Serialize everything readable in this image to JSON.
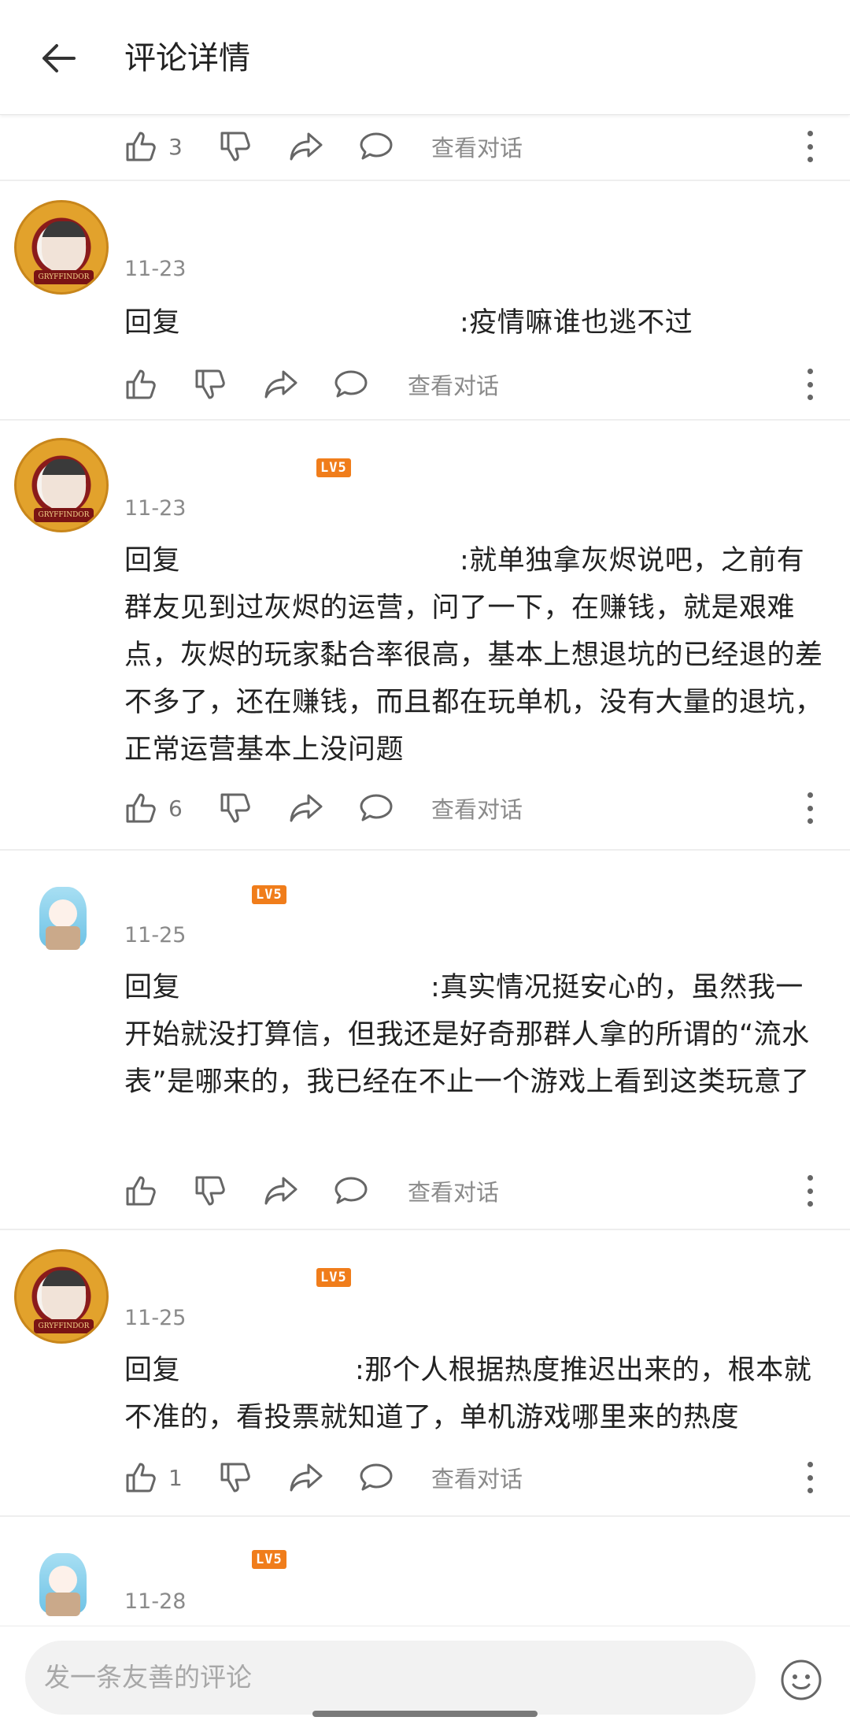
{
  "header": {
    "title": "评论详情"
  },
  "top_actions": {
    "like_count": "3",
    "view_dialog": "查看对话"
  },
  "comments": [
    {
      "date": "11-23",
      "reply_prefix": "回复",
      "reply_text": ":疫情嘛谁也逃不过",
      "like_count": "",
      "view_dialog": "查看对话"
    },
    {
      "date": "11-23",
      "level": "LV5",
      "reply_prefix": "回复",
      "reply_text": ":就单独拿灰烬说吧，之前有群友见到过灰烬的运营，问了一下，在赚钱，就是艰难点，灰烬的玩家黏合率很高，基本上想退坑的已经退的差不多了，还在赚钱，而且都在玩单机，没有大量的退坑，正常运营基本上没问题",
      "like_count": "6",
      "view_dialog": "查看对话"
    },
    {
      "date": "11-25",
      "level": "LV5",
      "reply_prefix": "回复",
      "reply_text": ":真实情况挺安心的，虽然我一开始就没打算信，但我还是好奇那群人拿的所谓的“流水表”是哪来的，我已经在不止一个游戏上看到这类玩意了",
      "like_count": "",
      "view_dialog": "查看对话"
    },
    {
      "date": "11-25",
      "level": "LV5",
      "reply_prefix": "回复",
      "reply_text": ":那个人根据热度推迟出来的，根本就不准的，看投票就知道了，单机游戏哪里来的热度",
      "like_count": "1",
      "view_dialog": "查看对话"
    },
    {
      "date": "11-28",
      "level": "LV5"
    }
  ],
  "avatar_text": "GRYFFINDOR",
  "bottom": {
    "input_placeholder": "发一条友善的评论"
  },
  "colors": {
    "level_badge": "#f07d1b",
    "muted_text": "#8a8a8a"
  }
}
